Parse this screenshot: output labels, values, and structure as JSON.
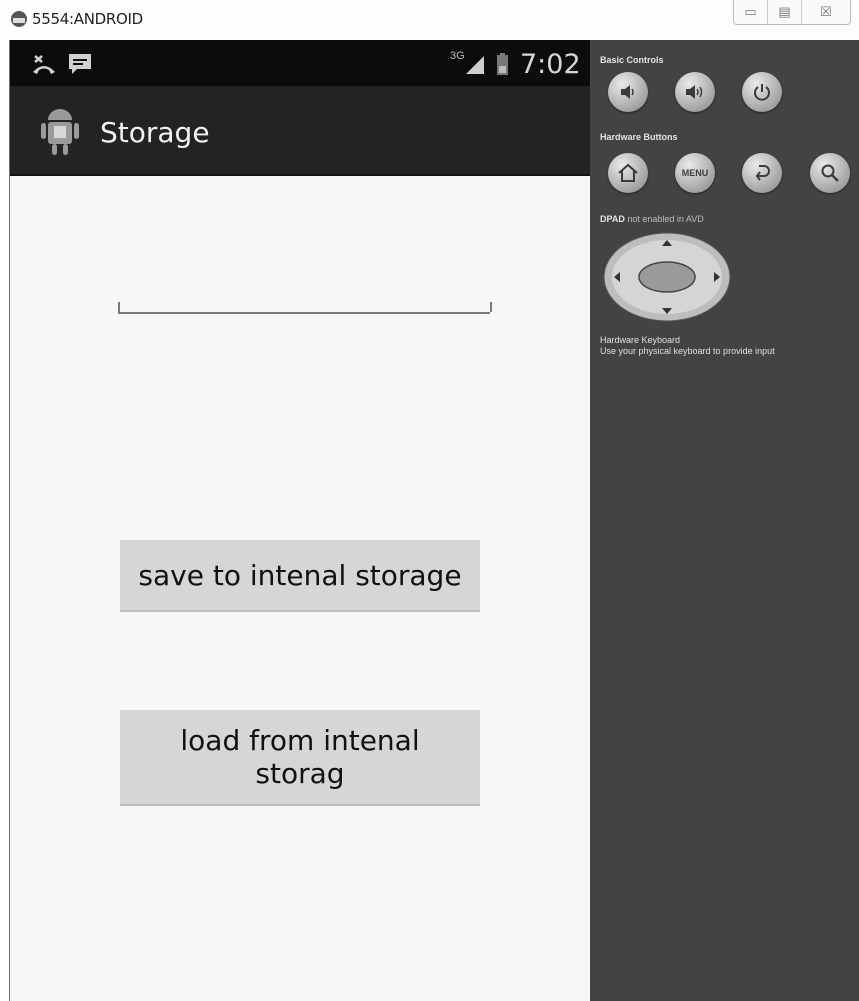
{
  "window": {
    "title": "5554:ANDROID",
    "controls": {
      "minimize": "▭",
      "maximize": "▤",
      "close": "☒"
    }
  },
  "device": {
    "status_bar": {
      "network": "3G",
      "clock": "7:02"
    },
    "action_bar": {
      "title": "Storage"
    },
    "content": {
      "edit_text": {
        "value": ""
      },
      "save_button": "save to intenal storage",
      "load_button": "load from intenal storag"
    }
  },
  "controls_panel": {
    "basic_controls_label": "Basic Controls",
    "hardware_buttons_label": "Hardware Buttons",
    "menu_label": "MENU",
    "dpad_label": "DPAD",
    "dpad_note": "not enabled in AVD",
    "keyboard_title": "Hardware Keyboard",
    "keyboard_note": "Use your physical keyboard to provide input"
  },
  "icons": [
    "emulator-icon",
    "missed-call-icon",
    "message-icon",
    "signal-icon",
    "battery-icon",
    "android-app-icon",
    "volume-down-icon",
    "volume-up-icon",
    "power-icon",
    "home-icon",
    "back-icon",
    "search-icon",
    "dpad-icon"
  ]
}
